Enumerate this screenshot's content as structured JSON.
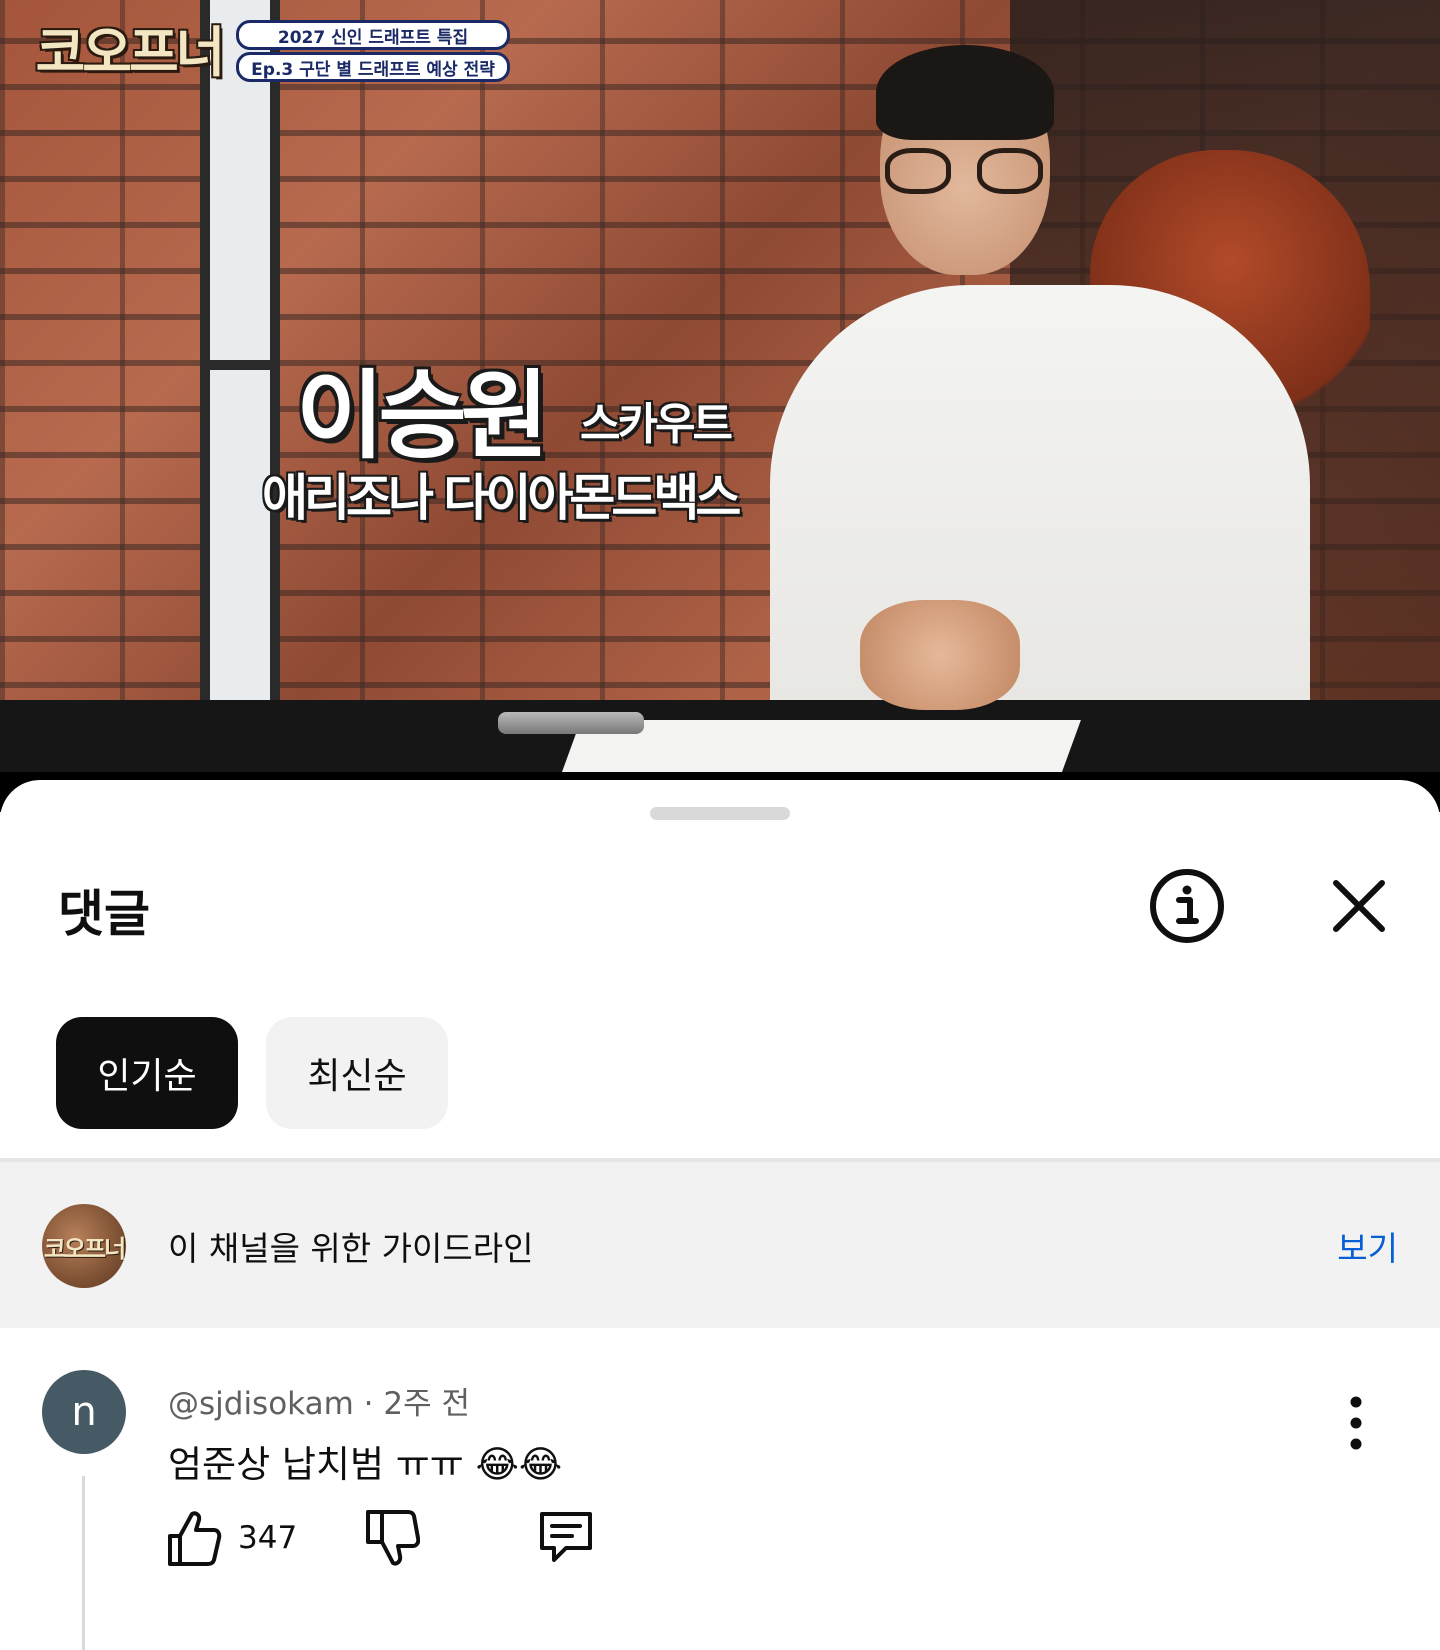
{
  "video": {
    "channel_logo": "코오프너",
    "title_line1": "2027 신인 드래프트 특집",
    "title_line2": "Ep.3 구단 별 드래프트 예상 전략",
    "caption_name": "이승원",
    "caption_role": "스카우트",
    "caption_team": "애리조나 다이아몬드백스",
    "progress_fraction": 0.01,
    "progress_color": "#ff0000"
  },
  "comments_sheet": {
    "title": "댓글",
    "info_icon": "info-icon",
    "close_icon": "close-icon",
    "sort_chips": [
      {
        "label": "인기순",
        "selected": true
      },
      {
        "label": "최신순",
        "selected": false
      }
    ],
    "guideline": {
      "avatar_text": "코오프너",
      "text": "이 채널을 위한 가이드라인",
      "link_label": "보기",
      "link_color": "#065fd4"
    },
    "comments": [
      {
        "avatar_letter": "n",
        "avatar_color": "#455a64",
        "author": "@sjdisokam",
        "separator": "·",
        "time": "2주 전",
        "text": "엄준상 납치범 ㅠㅠ 😂😂",
        "likes": "347",
        "like_icon": "thumbs-up-icon",
        "dislike_icon": "thumbs-down-icon",
        "reply_icon": "reply-icon",
        "more_icon": "more-vertical-icon"
      }
    ]
  }
}
